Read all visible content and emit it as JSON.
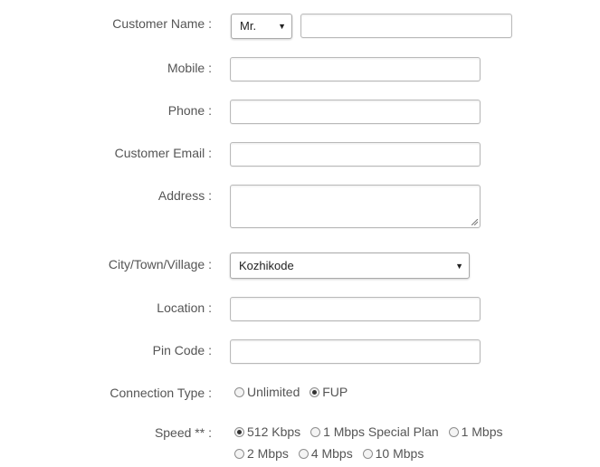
{
  "form": {
    "customer_name": {
      "label": "Customer Name :",
      "title_value": "Mr.",
      "name_value": ""
    },
    "mobile": {
      "label": "Mobile :",
      "value": ""
    },
    "phone": {
      "label": "Phone :",
      "value": ""
    },
    "email": {
      "label": "Customer Email :",
      "value": ""
    },
    "address": {
      "label": "Address :",
      "value": ""
    },
    "city": {
      "label": "City/Town/Village :",
      "value": "Kozhikode"
    },
    "location": {
      "label": "Location :",
      "value": ""
    },
    "pin": {
      "label": "Pin Code :",
      "value": ""
    },
    "connection_type": {
      "label": "Connection Type :",
      "options": [
        "Unlimited",
        "FUP"
      ],
      "selected": "FUP"
    },
    "speed": {
      "label": "Speed ** :",
      "options": [
        "512 Kbps",
        "1 Mbps Special Plan",
        "1 Mbps",
        "2 Mbps",
        "4 Mbps",
        "10 Mbps"
      ],
      "selected": "512 Kbps"
    }
  }
}
